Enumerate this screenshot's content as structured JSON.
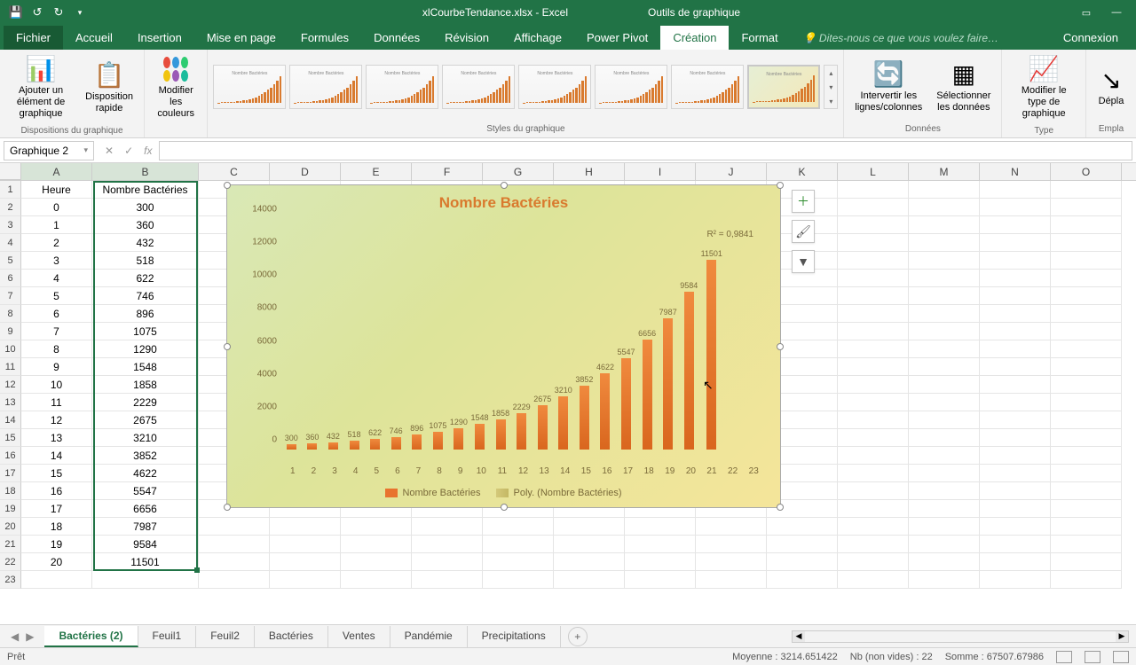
{
  "titlebar": {
    "title": "xlCourbeTendance.xlsx - Excel",
    "context": "Outils de graphique"
  },
  "tabs": {
    "file": "Fichier",
    "items": [
      "Accueil",
      "Insertion",
      "Mise en page",
      "Formules",
      "Données",
      "Révision",
      "Affichage",
      "Power Pivot",
      "Création",
      "Format"
    ],
    "active": "Création",
    "tell_me": "Dites-nous ce que vous voulez faire…",
    "share": "Connexion"
  },
  "ribbon": {
    "layouts": {
      "add": "Ajouter un élément de graphique",
      "quick": "Disposition rapide",
      "colors": "Modifier les couleurs",
      "group": "Dispositions du graphique"
    },
    "styles_group": "Styles du graphique",
    "data": {
      "switch": "Intervertir les lignes/colonnes",
      "select": "Sélectionner les données",
      "group": "Données"
    },
    "type": {
      "change": "Modifier le type de graphique",
      "group": "Type"
    },
    "move": {
      "label": "Dépla",
      "group": "Empla"
    }
  },
  "namebox": "Graphique 2",
  "sheets": {
    "items": [
      "Bactéries (2)",
      "Feuil1",
      "Feuil2",
      "Bactéries",
      "Ventes",
      "Pandémie",
      "Precipitations"
    ],
    "active": "Bactéries (2)"
  },
  "status": {
    "ready": "Prêt",
    "avg": "Moyenne : 3214.651422",
    "count": "Nb (non vides) : 22",
    "sum": "Somme : 67507.67986"
  },
  "columns": [
    "A",
    "B",
    "C",
    "D",
    "E",
    "F",
    "G",
    "H",
    "I",
    "J",
    "K",
    "L",
    "M",
    "N",
    "O"
  ],
  "table": {
    "headers": [
      "Heure",
      "Nombre Bactéries"
    ],
    "rows": [
      [
        "0",
        "300"
      ],
      [
        "1",
        "360"
      ],
      [
        "2",
        "432"
      ],
      [
        "3",
        "518"
      ],
      [
        "4",
        "622"
      ],
      [
        "5",
        "746"
      ],
      [
        "6",
        "896"
      ],
      [
        "7",
        "1075"
      ],
      [
        "8",
        "1290"
      ],
      [
        "9",
        "1548"
      ],
      [
        "10",
        "1858"
      ],
      [
        "11",
        "2229"
      ],
      [
        "12",
        "2675"
      ],
      [
        "13",
        "3210"
      ],
      [
        "14",
        "3852"
      ],
      [
        "15",
        "4622"
      ],
      [
        "16",
        "5547"
      ],
      [
        "17",
        "6656"
      ],
      [
        "18",
        "7987"
      ],
      [
        "19",
        "9584"
      ],
      [
        "20",
        "11501"
      ]
    ]
  },
  "chart_data": {
    "type": "bar",
    "title": "Nombre Bactéries",
    "categories": [
      "1",
      "2",
      "3",
      "4",
      "5",
      "6",
      "7",
      "8",
      "9",
      "10",
      "11",
      "12",
      "13",
      "14",
      "15",
      "16",
      "17",
      "18",
      "19",
      "20",
      "21",
      "22",
      "23"
    ],
    "series": [
      {
        "name": "Nombre Bactéries",
        "values": [
          300,
          360,
          432,
          518,
          622,
          746,
          896,
          1075,
          1290,
          1548,
          1858,
          2229,
          2675,
          3210,
          3852,
          4622,
          5547,
          6656,
          7987,
          9584,
          11501
        ]
      },
      {
        "name": "Poly. (Nombre Bactéries)",
        "type": "trendline"
      }
    ],
    "xlabel": "",
    "ylabel": "",
    "ylim": [
      0,
      14000
    ],
    "yticks": [
      0,
      2000,
      4000,
      6000,
      8000,
      10000,
      12000,
      14000
    ],
    "annotations": [
      "R² = 0,9841"
    ],
    "legend": [
      "Nombre Bactéries",
      "Poly. (Nombre Bactéries)"
    ],
    "data_labels": [
      "300",
      "360",
      "432",
      "518",
      "622",
      "746",
      "896",
      "1075",
      "1290",
      "1548",
      "1858",
      "2229",
      "2675",
      "3210",
      "3852",
      "4622",
      "5547",
      "6656",
      "7987",
      "9584",
      "11501"
    ]
  }
}
